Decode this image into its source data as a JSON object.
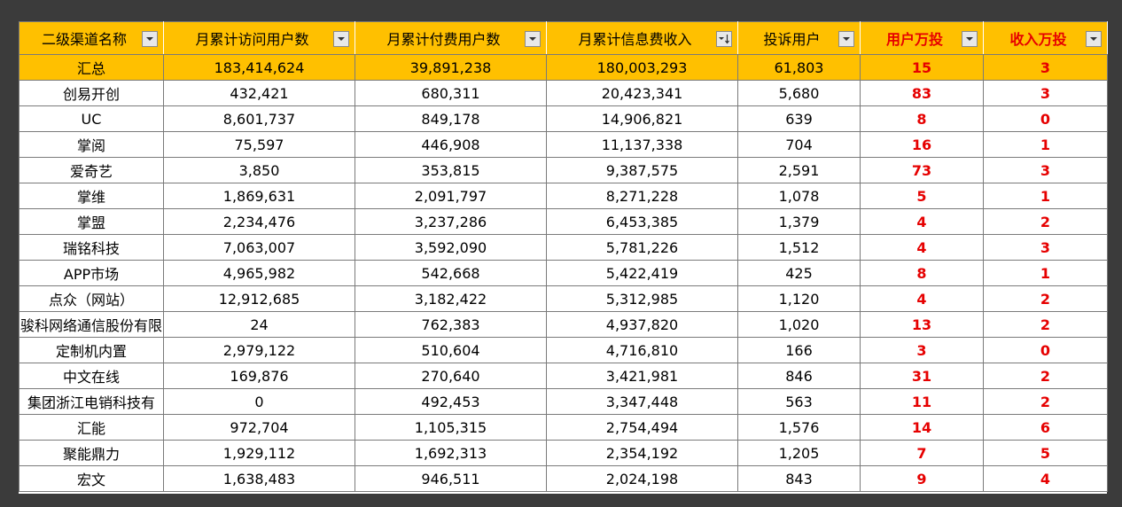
{
  "headers": [
    {
      "label": "二级渠道名称",
      "filter_icon": "dropdown-arrow-icon"
    },
    {
      "label": "月累计访问用户数",
      "filter_icon": "dropdown-arrow-icon"
    },
    {
      "label": "月累计付费用户数",
      "filter_icon": "dropdown-arrow-icon"
    },
    {
      "label": "月累计信息费收入",
      "filter_icon": "sort-descending-filter-icon"
    },
    {
      "label": "投诉用户",
      "filter_icon": "dropdown-arrow-icon"
    },
    {
      "label": "用户万投",
      "filter_icon": "dropdown-arrow-icon"
    },
    {
      "label": "收入万投",
      "filter_icon": "dropdown-arrow-icon"
    }
  ],
  "colors": {
    "header_bg": "#ffc000",
    "highlight_text": "#e60000",
    "background": "#3b3b3b"
  },
  "rows": [
    {
      "channel": "汇总",
      "visits": "183,414,624",
      "paying": "39,891,238",
      "revenue": "180,003,293",
      "complaints": "61,803",
      "user_rate": "15",
      "revenue_rate": "3"
    },
    {
      "channel": "创易开创",
      "visits": "432,421",
      "paying": "680,311",
      "revenue": "20,423,341",
      "complaints": "5,680",
      "user_rate": "83",
      "revenue_rate": "3"
    },
    {
      "channel": "UC",
      "visits": "8,601,737",
      "paying": "849,178",
      "revenue": "14,906,821",
      "complaints": "639",
      "user_rate": "8",
      "revenue_rate": "0"
    },
    {
      "channel": "掌阅",
      "visits": "75,597",
      "paying": "446,908",
      "revenue": "11,137,338",
      "complaints": "704",
      "user_rate": "16",
      "revenue_rate": "1"
    },
    {
      "channel": "爱奇艺",
      "visits": "3,850",
      "paying": "353,815",
      "revenue": "9,387,575",
      "complaints": "2,591",
      "user_rate": "73",
      "revenue_rate": "3"
    },
    {
      "channel": "掌维",
      "visits": "1,869,631",
      "paying": "2,091,797",
      "revenue": "8,271,228",
      "complaints": "1,078",
      "user_rate": "5",
      "revenue_rate": "1"
    },
    {
      "channel": "掌盟",
      "visits": "2,234,476",
      "paying": "3,237,286",
      "revenue": "6,453,385",
      "complaints": "1,379",
      "user_rate": "4",
      "revenue_rate": "2"
    },
    {
      "channel": "瑞铭科技",
      "visits": "7,063,007",
      "paying": "3,592,090",
      "revenue": "5,781,226",
      "complaints": "1,512",
      "user_rate": "4",
      "revenue_rate": "3"
    },
    {
      "channel": "APP市场",
      "visits": "4,965,982",
      "paying": "542,668",
      "revenue": "5,422,419",
      "complaints": "425",
      "user_rate": "8",
      "revenue_rate": "1"
    },
    {
      "channel": "点众（网站）",
      "visits": "12,912,685",
      "paying": "3,182,422",
      "revenue": "5,312,985",
      "complaints": "1,120",
      "user_rate": "4",
      "revenue_rate": "2"
    },
    {
      "channel": "骏科网络通信股份有限",
      "visits": "24",
      "paying": "762,383",
      "revenue": "4,937,820",
      "complaints": "1,020",
      "user_rate": "13",
      "revenue_rate": "2"
    },
    {
      "channel": "定制机内置",
      "visits": "2,979,122",
      "paying": "510,604",
      "revenue": "4,716,810",
      "complaints": "166",
      "user_rate": "3",
      "revenue_rate": "0"
    },
    {
      "channel": "中文在线",
      "visits": "169,876",
      "paying": "270,640",
      "revenue": "3,421,981",
      "complaints": "846",
      "user_rate": "31",
      "revenue_rate": "2"
    },
    {
      "channel": "集团浙江电销科技有",
      "visits": "0",
      "paying": "492,453",
      "revenue": "3,347,448",
      "complaints": "563",
      "user_rate": "11",
      "revenue_rate": "2"
    },
    {
      "channel": "汇能",
      "visits": "972,704",
      "paying": "1,105,315",
      "revenue": "2,754,494",
      "complaints": "1,576",
      "user_rate": "14",
      "revenue_rate": "6"
    },
    {
      "channel": "聚能鼎力",
      "visits": "1,929,112",
      "paying": "1,692,313",
      "revenue": "2,354,192",
      "complaints": "1,205",
      "user_rate": "7",
      "revenue_rate": "5"
    },
    {
      "channel": "宏文",
      "visits": "1,638,483",
      "paying": "946,511",
      "revenue": "2,024,198",
      "complaints": "843",
      "user_rate": "9",
      "revenue_rate": "4"
    }
  ]
}
